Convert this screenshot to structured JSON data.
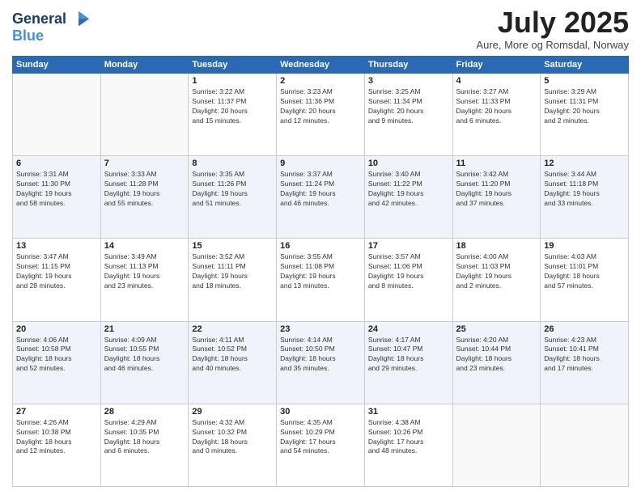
{
  "logo": {
    "line1": "General",
    "line2": "Blue"
  },
  "title": "July 2025",
  "location": "Aure, More og Romsdal, Norway",
  "days_of_week": [
    "Sunday",
    "Monday",
    "Tuesday",
    "Wednesday",
    "Thursday",
    "Friday",
    "Saturday"
  ],
  "weeks": [
    [
      {
        "num": "",
        "info": ""
      },
      {
        "num": "",
        "info": ""
      },
      {
        "num": "1",
        "info": "Sunrise: 3:22 AM\nSunset: 11:37 PM\nDaylight: 20 hours\nand 15 minutes."
      },
      {
        "num": "2",
        "info": "Sunrise: 3:23 AM\nSunset: 11:36 PM\nDaylight: 20 hours\nand 12 minutes."
      },
      {
        "num": "3",
        "info": "Sunrise: 3:25 AM\nSunset: 11:34 PM\nDaylight: 20 hours\nand 9 minutes."
      },
      {
        "num": "4",
        "info": "Sunrise: 3:27 AM\nSunset: 11:33 PM\nDaylight: 20 hours\nand 6 minutes."
      },
      {
        "num": "5",
        "info": "Sunrise: 3:29 AM\nSunset: 11:31 PM\nDaylight: 20 hours\nand 2 minutes."
      }
    ],
    [
      {
        "num": "6",
        "info": "Sunrise: 3:31 AM\nSunset: 11:30 PM\nDaylight: 19 hours\nand 58 minutes."
      },
      {
        "num": "7",
        "info": "Sunrise: 3:33 AM\nSunset: 11:28 PM\nDaylight: 19 hours\nand 55 minutes."
      },
      {
        "num": "8",
        "info": "Sunrise: 3:35 AM\nSunset: 11:26 PM\nDaylight: 19 hours\nand 51 minutes."
      },
      {
        "num": "9",
        "info": "Sunrise: 3:37 AM\nSunset: 11:24 PM\nDaylight: 19 hours\nand 46 minutes."
      },
      {
        "num": "10",
        "info": "Sunrise: 3:40 AM\nSunset: 11:22 PM\nDaylight: 19 hours\nand 42 minutes."
      },
      {
        "num": "11",
        "info": "Sunrise: 3:42 AM\nSunset: 11:20 PM\nDaylight: 19 hours\nand 37 minutes."
      },
      {
        "num": "12",
        "info": "Sunrise: 3:44 AM\nSunset: 11:18 PM\nDaylight: 19 hours\nand 33 minutes."
      }
    ],
    [
      {
        "num": "13",
        "info": "Sunrise: 3:47 AM\nSunset: 11:15 PM\nDaylight: 19 hours\nand 28 minutes."
      },
      {
        "num": "14",
        "info": "Sunrise: 3:49 AM\nSunset: 11:13 PM\nDaylight: 19 hours\nand 23 minutes."
      },
      {
        "num": "15",
        "info": "Sunrise: 3:52 AM\nSunset: 11:11 PM\nDaylight: 19 hours\nand 18 minutes."
      },
      {
        "num": "16",
        "info": "Sunrise: 3:55 AM\nSunset: 11:08 PM\nDaylight: 19 hours\nand 13 minutes."
      },
      {
        "num": "17",
        "info": "Sunrise: 3:57 AM\nSunset: 11:06 PM\nDaylight: 19 hours\nand 8 minutes."
      },
      {
        "num": "18",
        "info": "Sunrise: 4:00 AM\nSunset: 11:03 PM\nDaylight: 19 hours\nand 2 minutes."
      },
      {
        "num": "19",
        "info": "Sunrise: 4:03 AM\nSunset: 11:01 PM\nDaylight: 18 hours\nand 57 minutes."
      }
    ],
    [
      {
        "num": "20",
        "info": "Sunrise: 4:06 AM\nSunset: 10:58 PM\nDaylight: 18 hours\nand 52 minutes."
      },
      {
        "num": "21",
        "info": "Sunrise: 4:09 AM\nSunset: 10:55 PM\nDaylight: 18 hours\nand 46 minutes."
      },
      {
        "num": "22",
        "info": "Sunrise: 4:11 AM\nSunset: 10:52 PM\nDaylight: 18 hours\nand 40 minutes."
      },
      {
        "num": "23",
        "info": "Sunrise: 4:14 AM\nSunset: 10:50 PM\nDaylight: 18 hours\nand 35 minutes."
      },
      {
        "num": "24",
        "info": "Sunrise: 4:17 AM\nSunset: 10:47 PM\nDaylight: 18 hours\nand 29 minutes."
      },
      {
        "num": "25",
        "info": "Sunrise: 4:20 AM\nSunset: 10:44 PM\nDaylight: 18 hours\nand 23 minutes."
      },
      {
        "num": "26",
        "info": "Sunrise: 4:23 AM\nSunset: 10:41 PM\nDaylight: 18 hours\nand 17 minutes."
      }
    ],
    [
      {
        "num": "27",
        "info": "Sunrise: 4:26 AM\nSunset: 10:38 PM\nDaylight: 18 hours\nand 12 minutes."
      },
      {
        "num": "28",
        "info": "Sunrise: 4:29 AM\nSunset: 10:35 PM\nDaylight: 18 hours\nand 6 minutes."
      },
      {
        "num": "29",
        "info": "Sunrise: 4:32 AM\nSunset: 10:32 PM\nDaylight: 18 hours\nand 0 minutes."
      },
      {
        "num": "30",
        "info": "Sunrise: 4:35 AM\nSunset: 10:29 PM\nDaylight: 17 hours\nand 54 minutes."
      },
      {
        "num": "31",
        "info": "Sunrise: 4:38 AM\nSunset: 10:26 PM\nDaylight: 17 hours\nand 48 minutes."
      },
      {
        "num": "",
        "info": ""
      },
      {
        "num": "",
        "info": ""
      }
    ]
  ]
}
